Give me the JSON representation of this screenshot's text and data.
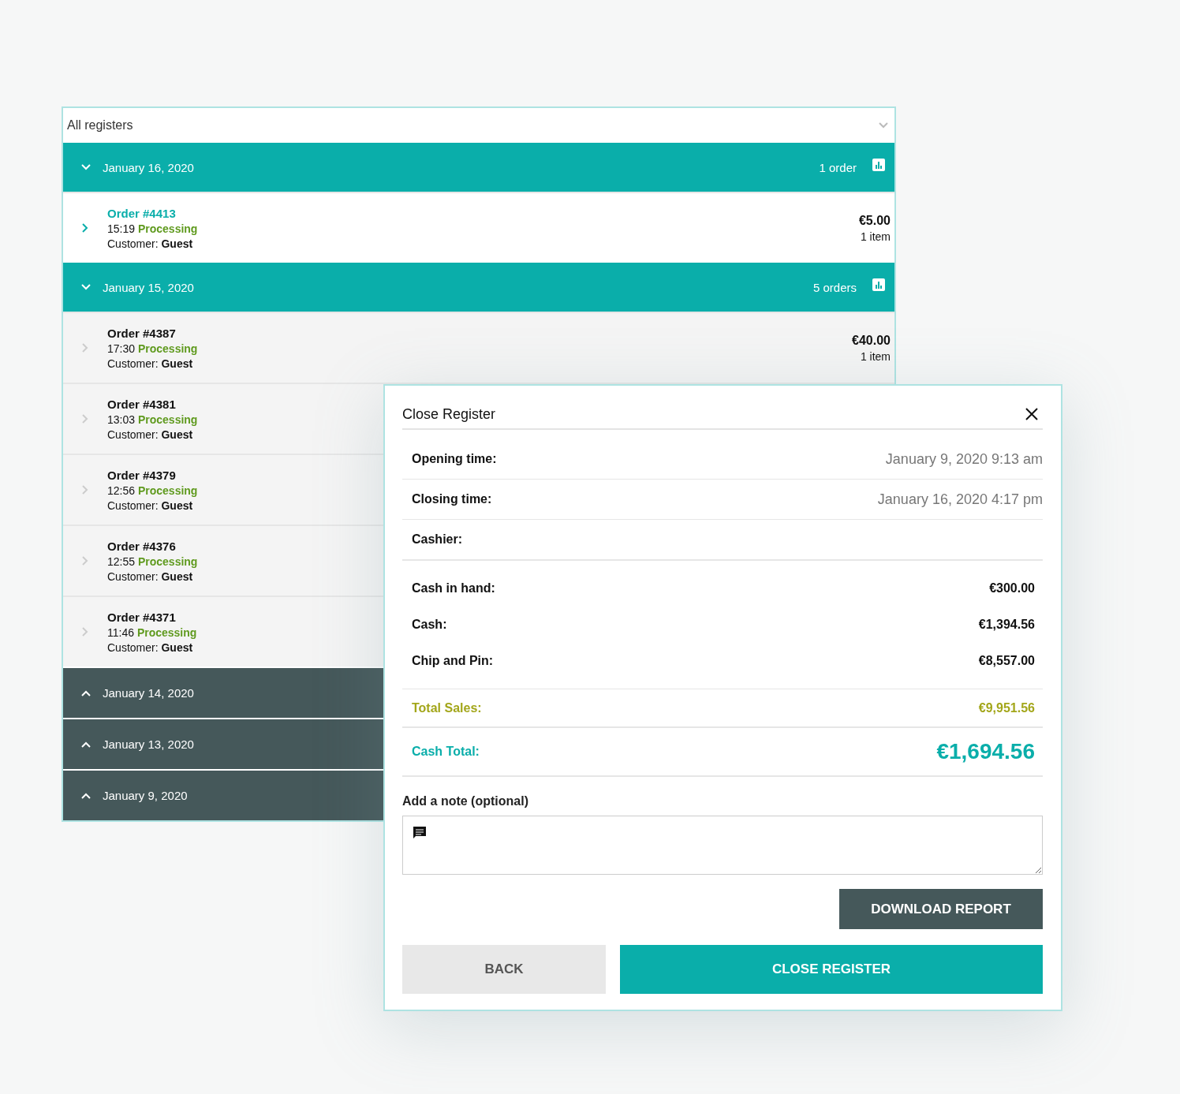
{
  "register_select": {
    "value": "All registers"
  },
  "groups": [
    {
      "date": "January 16, 2020",
      "expanded": true,
      "count": "1 order",
      "orders": [
        {
          "title": "Order #4413",
          "time": "15:19",
          "status": "Processing",
          "customer_label": "Customer:",
          "customer": "Guest",
          "total": "€5.00",
          "items": "1 item",
          "selected": true
        }
      ]
    },
    {
      "date": "January 15, 2020",
      "expanded": true,
      "count": "5 orders",
      "orders": [
        {
          "title": "Order #4387",
          "time": "17:30",
          "status": "Processing",
          "customer_label": "Customer:",
          "customer": "Guest",
          "total": "€40.00",
          "items": "1 item",
          "selected": false
        },
        {
          "title": "Order #4381",
          "time": "13:03",
          "status": "Processing",
          "customer_label": "Customer:",
          "customer": "Guest",
          "selected": false
        },
        {
          "title": "Order #4379",
          "time": "12:56",
          "status": "Processing",
          "customer_label": "Customer:",
          "customer": "Guest",
          "selected": false
        },
        {
          "title": "Order #4376",
          "time": "12:55",
          "status": "Processing",
          "customer_label": "Customer:",
          "customer": "Guest",
          "selected": false
        },
        {
          "title": "Order #4371",
          "time": "11:46",
          "status": "Processing",
          "customer_label": "Customer:",
          "customer": "Guest",
          "selected": false
        }
      ]
    },
    {
      "date": "January 14, 2020",
      "expanded": false
    },
    {
      "date": "January 13, 2020",
      "expanded": false
    },
    {
      "date": "January 9, 2020",
      "expanded": false
    }
  ],
  "modal": {
    "title": "Close Register",
    "rows": [
      {
        "kind": "time",
        "label": "Opening time:",
        "value": "January 9, 2020 9:13 am"
      },
      {
        "kind": "time",
        "label": "Closing time:",
        "value": "January 16, 2020 4:17 pm"
      },
      {
        "kind": "time",
        "label": "Cashier:"
      },
      {
        "kind": "amount",
        "label": "Cash in hand:",
        "value": "€300.00"
      },
      {
        "kind": "amount",
        "label": "Cash:",
        "value": "€1,394.56"
      },
      {
        "kind": "amount",
        "label": "Chip and Pin:",
        "value": "€8,557.00"
      },
      {
        "kind": "total_sales",
        "label": "Total Sales:",
        "value": "€9,951.56"
      },
      {
        "kind": "cash_total",
        "label": "Cash Total:",
        "value": "€1,694.56"
      }
    ],
    "note_label": "Add a note (optional)",
    "download_button": "DOWNLOAD REPORT",
    "back_button": "BACK",
    "close_button": "CLOSE REGISTER"
  }
}
